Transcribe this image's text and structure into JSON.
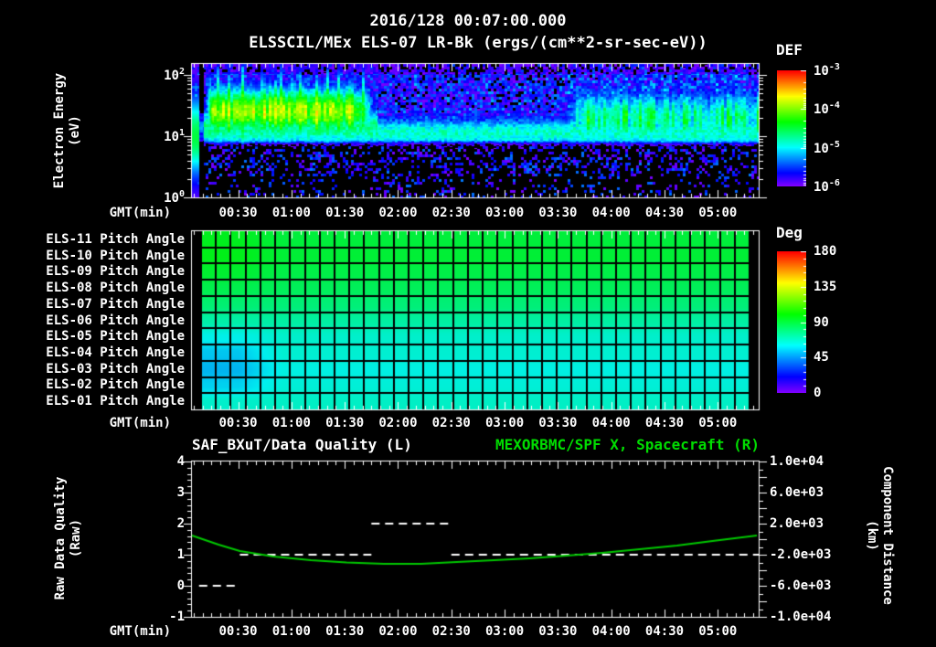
{
  "header": {
    "timestamp": "2016/128 00:07:00.000",
    "title": "ELSSCIL/MEx ELS-07 LR-Bk  (ergs/(cm**2-sr-sec-eV))"
  },
  "time_axis": {
    "label": "GMT(min)",
    "start_min": 4,
    "end_min": 323,
    "minor_step_min": 5,
    "ticks": [
      {
        "min": 30,
        "label": "00:30"
      },
      {
        "min": 60,
        "label": "01:00"
      },
      {
        "min": 90,
        "label": "01:30"
      },
      {
        "min": 120,
        "label": "02:00"
      },
      {
        "min": 150,
        "label": "02:30"
      },
      {
        "min": 180,
        "label": "03:00"
      },
      {
        "min": 210,
        "label": "03:30"
      },
      {
        "min": 240,
        "label": "04:00"
      },
      {
        "min": 270,
        "label": "04:30"
      },
      {
        "min": 300,
        "label": "05:00"
      }
    ]
  },
  "chart_data": [
    {
      "type": "heatmap",
      "name": "electron-energy-spectrogram",
      "title": "ELSSCIL/MEx ELS-07 LR-Bk",
      "ylabel": {
        "line1": "Electron Energy",
        "line2": "(eV)"
      },
      "y_scale": "log",
      "ylim_eV": [
        1,
        146
      ],
      "energy_ticks": [
        {
          "base": "10",
          "exp": "2",
          "value_eV": 100
        },
        {
          "base": "10",
          "exp": "1",
          "value_eV": 10
        },
        {
          "base": "10",
          "exp": "0",
          "value_eV": 1
        }
      ],
      "colorbar": {
        "label": "DEF",
        "units": "ergs/(cm**2-sr-sec-eV)",
        "scale": "log",
        "range": [
          1e-06,
          0.001
        ],
        "ticks": [
          {
            "base": "10",
            "exp": "-3"
          },
          {
            "base": "10",
            "exp": "-4"
          },
          {
            "base": "10",
            "exp": "-5"
          },
          {
            "base": "10",
            "exp": "-6"
          }
        ]
      },
      "features": {
        "core_band": {
          "t_min": [
            4,
            323
          ],
          "center_eV": 12,
          "sigma_decades": 0.22,
          "peak_log10_flux": -4.75
        },
        "enhanced_blob": {
          "t_min": [
            12,
            108
          ],
          "center_eV": 26,
          "sigma_decades": 0.26,
          "peak_log10_flux": -3.85
        },
        "late_broadening": {
          "t_min": [
            212,
            323
          ],
          "center_eV": 20,
          "sigma_decades": 0.3,
          "peak_log10_flux": -4.55
        },
        "background_log10_flux": -5.75,
        "low_energy_cutoff_eV": 8,
        "speckle_fraction": 0.36
      }
    },
    {
      "type": "heatmap",
      "name": "pitch-angle-grid",
      "columns": 37,
      "colorbar": {
        "label": "Deg",
        "range": [
          0,
          180
        ],
        "ticks": [
          180,
          135,
          90,
          45,
          0
        ]
      },
      "rows": [
        {
          "label": "ELS-11 Pitch Angle",
          "mean_deg": 90,
          "left_edge_deg": 95
        },
        {
          "label": "ELS-10 Pitch Angle",
          "mean_deg": 91,
          "left_edge_deg": 96
        },
        {
          "label": "ELS-09 Pitch Angle",
          "mean_deg": 88,
          "left_edge_deg": 92
        },
        {
          "label": "ELS-08 Pitch Angle",
          "mean_deg": 85,
          "left_edge_deg": 87
        },
        {
          "label": "ELS-07 Pitch Angle",
          "mean_deg": 80,
          "left_edge_deg": 81
        },
        {
          "label": "ELS-06 Pitch Angle",
          "mean_deg": 73,
          "left_edge_deg": 72
        },
        {
          "label": "ELS-05 Pitch Angle",
          "mean_deg": 66,
          "left_edge_deg": 61
        },
        {
          "label": "ELS-04 Pitch Angle",
          "mean_deg": 65,
          "left_edge_deg": 53
        },
        {
          "label": "ELS-03 Pitch Angle",
          "mean_deg": 62,
          "left_edge_deg": 50
        },
        {
          "label": "ELS-02 Pitch Angle",
          "mean_deg": 64,
          "left_edge_deg": 55
        },
        {
          "label": "ELS-01 Pitch Angle",
          "mean_deg": 67,
          "left_edge_deg": 66
        }
      ]
    },
    {
      "type": "line",
      "name": "quality-and-distance",
      "title_left": "SAF_BXuT/Data Quality (L)",
      "title_right": "MEXORBMC/SPF X, Spacecraft (R)",
      "left_axis": {
        "label": {
          "line1": "Raw Data Quality",
          "line2": "(Raw)"
        },
        "range": [
          -1,
          4
        ],
        "ticks": [
          4,
          3,
          2,
          1,
          0,
          -1
        ],
        "minor_step": 0.2
      },
      "right_axis": {
        "label": {
          "line1": "Component Distance",
          "line2": "(km)"
        },
        "range": [
          -10000,
          10000
        ],
        "ticks": [
          {
            "value": 10000,
            "label": "1.0e+04"
          },
          {
            "value": 6000,
            "label": "6.0e+03"
          },
          {
            "value": 2000,
            "label": "2.0e+03"
          },
          {
            "value": -2000,
            "label": "-2.0e+03"
          },
          {
            "value": -6000,
            "label": "-6.0e+03"
          },
          {
            "value": -10000,
            "label": "-1.0e+04"
          }
        ],
        "minor_step": 1000,
        "major_step": 2000
      },
      "series": [
        {
          "name": "SAF_BXuT/Data Quality",
          "axis": "left",
          "style": "dashed",
          "color": "#ffffff",
          "steps": [
            {
              "t_min": [
                8,
                31
              ],
              "value": 0
            },
            {
              "t_min": [
                31,
                105
              ],
              "value": 1
            },
            {
              "t_min": [
                105,
                150
              ],
              "value": 2
            },
            {
              "t_min": [
                150,
                323
              ],
              "value": 1
            }
          ]
        },
        {
          "name": "MEXORBMC/SPF X Spacecraft",
          "axis": "right",
          "style": "solid",
          "color": "#00c800",
          "t_min": [
            4,
            19,
            31,
            50,
            71,
            91,
            112,
            133,
            153,
            174,
            194,
            215,
            235,
            256,
            277,
            297,
            322
          ],
          "values_km": [
            470,
            -700,
            -1530,
            -2240,
            -2710,
            -3000,
            -3180,
            -3180,
            -2940,
            -2710,
            -2470,
            -2120,
            -1760,
            -1290,
            -820,
            -235,
            470
          ]
        }
      ]
    }
  ],
  "colors": {
    "background": "#000000",
    "text": "#ffffff",
    "frame": "#ffffff",
    "green_title": "#00dd00",
    "distance_line": "#00c800",
    "quality_line": "#ffffff"
  }
}
